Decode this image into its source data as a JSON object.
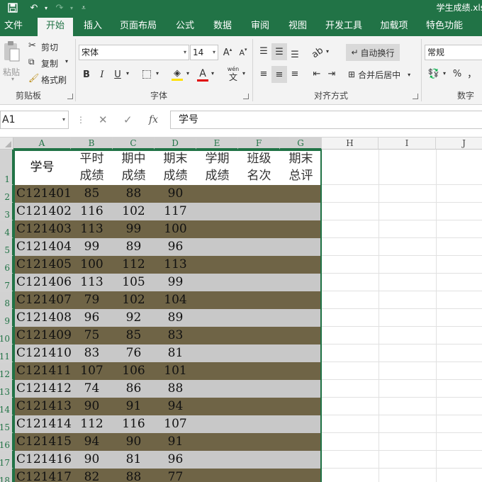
{
  "window": {
    "title": "学生成绩.xls"
  },
  "tabs": [
    "文件",
    "开始",
    "插入",
    "页面布局",
    "公式",
    "数据",
    "审阅",
    "视图",
    "开发工具",
    "加载项",
    "特色功能"
  ],
  "active_tab": "开始",
  "ribbon": {
    "clipboard": {
      "paste": "粘贴",
      "cut": "剪切",
      "copy": "复制",
      "format_painter": "格式刷",
      "label": "剪贴板"
    },
    "font": {
      "name": "宋体",
      "size": "14",
      "label": "字体",
      "phonetic": "wén",
      "font_color": "#e00000",
      "fill_color": "#ffe000"
    },
    "alignment": {
      "wrap_text": "自动换行",
      "merge_center": "合并后居中",
      "label": "对齐方式"
    },
    "number": {
      "format": "常规",
      "percent": "%",
      "comma": "，",
      "label": "数字"
    }
  },
  "formula_bar": {
    "name_box": "A1",
    "fx": "fx",
    "content": "学号"
  },
  "sheet": {
    "columns": [
      "A",
      "B",
      "C",
      "D",
      "E",
      "F",
      "G",
      "H",
      "I",
      "J"
    ],
    "row_numbers": [
      "1",
      "2",
      "3",
      "4",
      "5",
      "6",
      "7",
      "8",
      "9",
      "10",
      "11",
      "12",
      "13",
      "14",
      "15",
      "16",
      "17",
      "18"
    ],
    "header": {
      "id": "学号",
      "regular": [
        "平时",
        "成绩"
      ],
      "midterm": [
        "期中",
        "成绩"
      ],
      "final": [
        "期末",
        "成绩"
      ],
      "semester": [
        "学期",
        "成绩"
      ],
      "rank": [
        "班级",
        "名次"
      ],
      "review": [
        "期末",
        "总评"
      ]
    },
    "band_colors": {
      "dark": "#6f6446",
      "light": "#c8c8c8"
    },
    "rows": [
      {
        "id": "C121401",
        "regular": "85",
        "midterm": "88",
        "final": "90"
      },
      {
        "id": "C121402",
        "regular": "116",
        "midterm": "102",
        "final": "117"
      },
      {
        "id": "C121403",
        "regular": "113",
        "midterm": "99",
        "final": "100"
      },
      {
        "id": "C121404",
        "regular": "99",
        "midterm": "89",
        "final": "96"
      },
      {
        "id": "C121405",
        "regular": "100",
        "midterm": "112",
        "final": "113"
      },
      {
        "id": "C121406",
        "regular": "113",
        "midterm": "105",
        "final": "99"
      },
      {
        "id": "C121407",
        "regular": "79",
        "midterm": "102",
        "final": "104"
      },
      {
        "id": "C121408",
        "regular": "96",
        "midterm": "92",
        "final": "89"
      },
      {
        "id": "C121409",
        "regular": "75",
        "midterm": "85",
        "final": "83"
      },
      {
        "id": "C121410",
        "regular": "83",
        "midterm": "76",
        "final": "81"
      },
      {
        "id": "C121411",
        "regular": "107",
        "midterm": "106",
        "final": "101"
      },
      {
        "id": "C121412",
        "regular": "74",
        "midterm": "86",
        "final": "88"
      },
      {
        "id": "C121413",
        "regular": "90",
        "midterm": "91",
        "final": "94"
      },
      {
        "id": "C121414",
        "regular": "112",
        "midterm": "116",
        "final": "107"
      },
      {
        "id": "C121415",
        "regular": "94",
        "midterm": "90",
        "final": "91"
      },
      {
        "id": "C121416",
        "regular": "90",
        "midterm": "81",
        "final": "96"
      },
      {
        "id": "C121417",
        "regular": "82",
        "midterm": "88",
        "final": "77"
      }
    ]
  }
}
